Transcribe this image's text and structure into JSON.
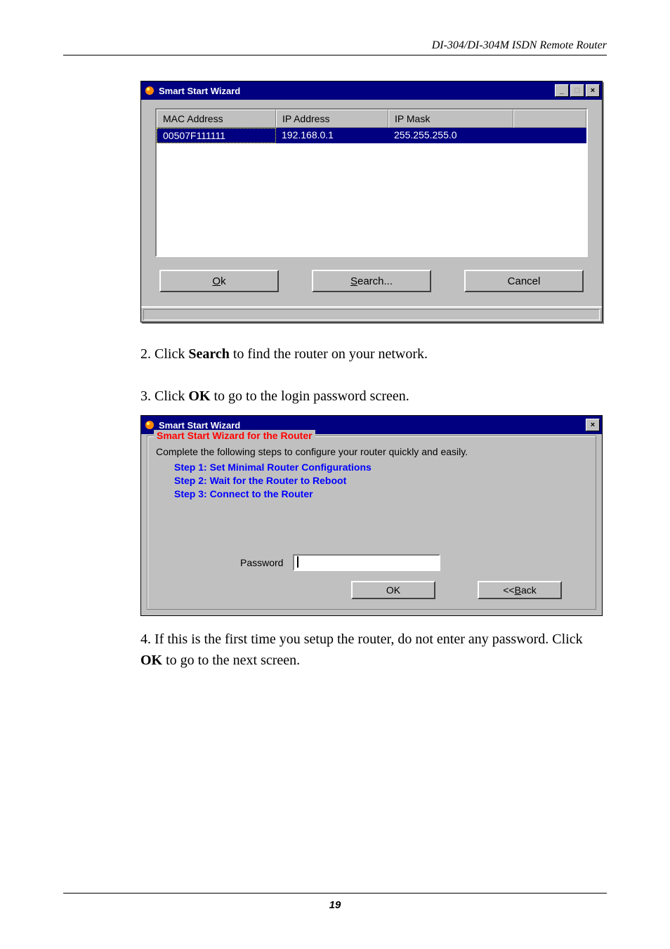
{
  "header": {
    "product": "DI-304/DI-304M ISDN Remote Router"
  },
  "win1": {
    "title": "Smart Start Wizard",
    "columns": {
      "mac": "MAC Address",
      "ip": "IP Address",
      "mask": "IP Mask"
    },
    "row": {
      "mac": "00507F111111",
      "ip": "192.168.0.1",
      "mask": "255.255.255.0"
    },
    "buttons": {
      "ok_prefix": "O",
      "ok_rest": "k",
      "search_prefix": "S",
      "search_rest": "earch...",
      "cancel": "Cancel"
    },
    "controls": {
      "minimize": "_",
      "maximize": "□",
      "close": "×"
    }
  },
  "instr": {
    "s2_a": "2. Click ",
    "s2_b": "Search",
    "s2_c": " to find the router on your network.",
    "s3_a": "3. Click ",
    "s3_b": "OK",
    "s3_c": " to go to the login password screen.",
    "s4_a": "4. If this is the first time you setup the router, do not enter any password. Click ",
    "s4_b": "OK",
    "s4_c": " to go to the next screen."
  },
  "win2": {
    "title": "Smart Start Wizard",
    "group_title": "Smart Start Wizard for the Router",
    "desc": "Complete the following steps to configure your router quickly and easily.",
    "step1": "Step 1: Set Minimal Router Configurations",
    "step2": "Step 2: Wait for the Router to Reboot",
    "step3": "Step 3: Connect to the Router",
    "password_label": "Password",
    "password_value": "",
    "buttons": {
      "ok": "OK",
      "back_prefix": "<<",
      "back_u": "B",
      "back_rest": "ack"
    },
    "close": "×"
  },
  "footer": {
    "page": "19"
  }
}
